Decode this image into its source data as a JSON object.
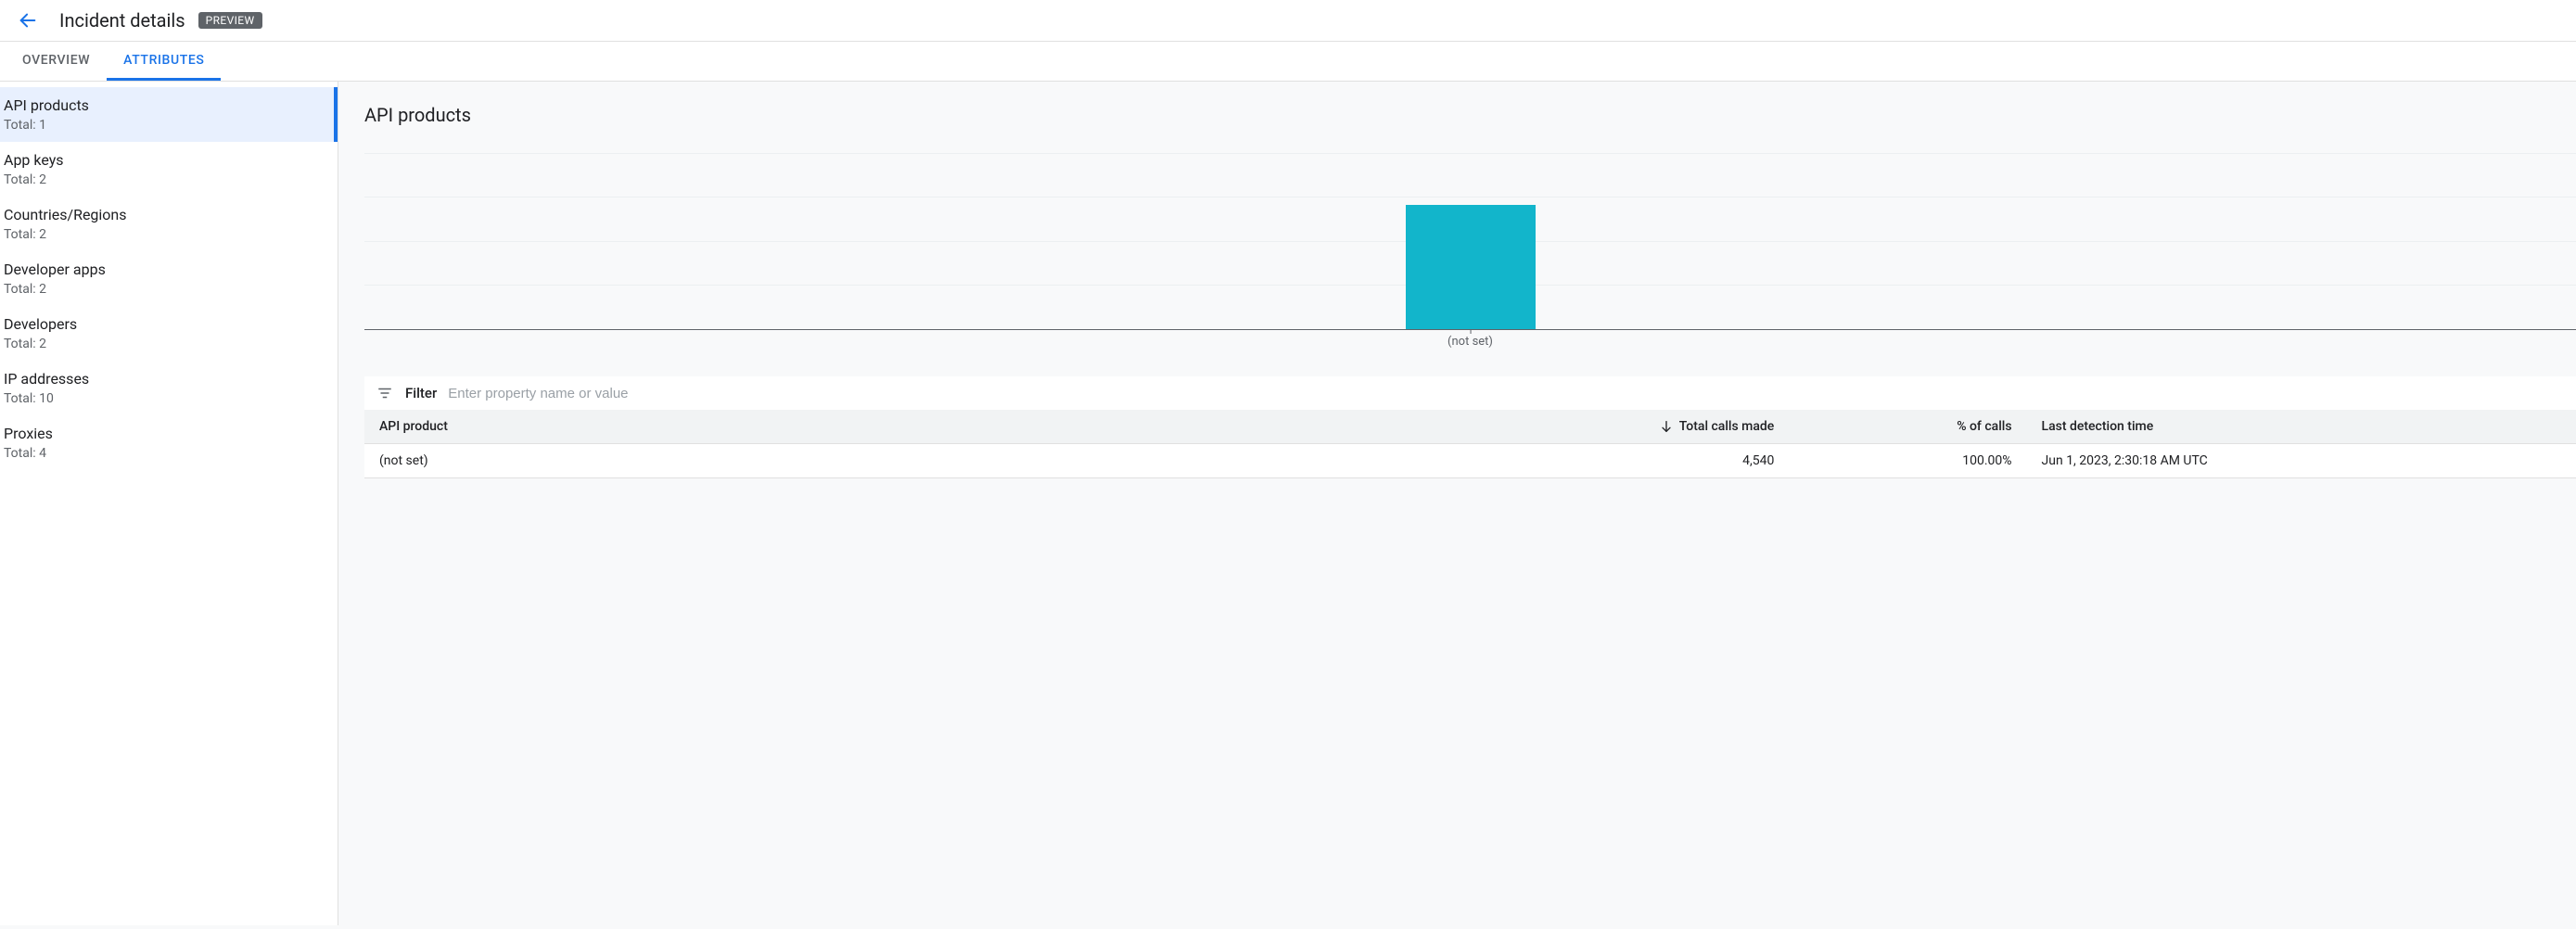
{
  "header": {
    "title": "Incident details",
    "badge": "PREVIEW"
  },
  "tabs": [
    {
      "id": "overview",
      "label": "OVERVIEW",
      "active": false
    },
    {
      "id": "attributes",
      "label": "ATTRIBUTES",
      "active": true
    }
  ],
  "sidebar": {
    "total_prefix": "Total: ",
    "items": [
      {
        "name": "API products",
        "total": 1,
        "selected": true
      },
      {
        "name": "App keys",
        "total": 2,
        "selected": false
      },
      {
        "name": "Countries/Regions",
        "total": 2,
        "selected": false
      },
      {
        "name": "Developer apps",
        "total": 2,
        "selected": false
      },
      {
        "name": "Developers",
        "total": 2,
        "selected": false
      },
      {
        "name": "IP addresses",
        "total": 10,
        "selected": false
      },
      {
        "name": "Proxies",
        "total": 4,
        "selected": false
      }
    ]
  },
  "main": {
    "heading": "API products",
    "filter": {
      "label": "Filter",
      "placeholder": "Enter property name or value"
    },
    "table": {
      "sort_column": 1,
      "sort_dir": "desc",
      "columns": [
        {
          "label": "API product",
          "align": "left"
        },
        {
          "label": "Total calls made",
          "align": "right"
        },
        {
          "label": "% of calls",
          "align": "right"
        },
        {
          "label": "Last detection time",
          "align": "left"
        }
      ],
      "rows": [
        {
          "product": "(not set)",
          "calls": "4,540",
          "pct": "100.00%",
          "last": "Jun 1, 2023, 2:30:18 AM UTC"
        }
      ]
    }
  },
  "chart_data": {
    "type": "bar",
    "categories": [
      "(not set)"
    ],
    "values": [
      4540
    ],
    "title": "",
    "xlabel": "",
    "ylabel": "",
    "ylim": [
      0,
      5000
    ],
    "bar_color": "#12b5cb"
  }
}
